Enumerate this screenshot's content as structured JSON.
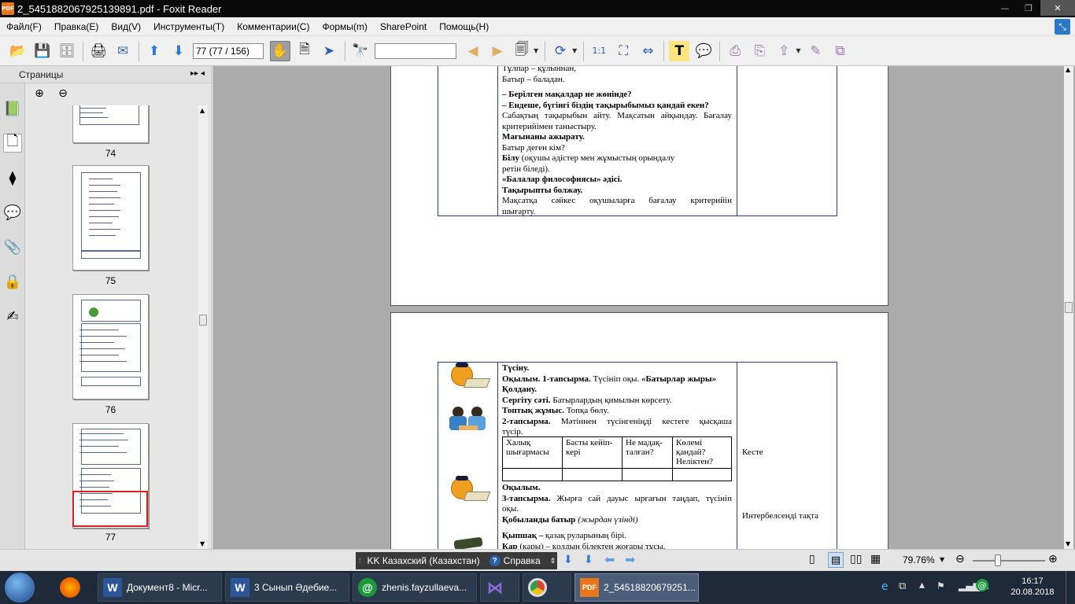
{
  "window": {
    "title": "2_5451882067925139891.pdf - Foxit Reader",
    "app_icon": "PDF"
  },
  "menu": [
    "Файл(F)",
    "Правка(E)",
    "Вид(V)",
    "Инструменты(T)",
    "Комментарии(C)",
    "Формы(m)",
    "SharePoint",
    "Помощь(H)"
  ],
  "toolbar": {
    "page_value": "77 (77 / 156)",
    "find_value": ""
  },
  "sidebar": {
    "title": "Страницы",
    "thumbs": [
      {
        "label": "74"
      },
      {
        "label": "75"
      },
      {
        "label": "76"
      },
      {
        "label": "77"
      }
    ]
  },
  "page_a": {
    "lines": [
      "Тұлпар – құлыннан,",
      "Батыр – баладан."
    ],
    "q1": "– Берілген мақалдар не жөнінде?",
    "q2": "– Ендеше, бүгінгі біздің тақырыбымыз қандай екен?",
    "p1a": "Сабақтың тақырыбын айту. Мақсатын айқындау. Бағалау",
    "p1b": "критерийімен таныстыру.",
    "h1": "Мағынаны ажырату.",
    "l1": "Батыр деген кім?",
    "l2_b": "Білу",
    "l2": " (оқушы әдістер мен жұмыстың орындалу",
    "l3": "ретін біледі).",
    "h2": "«Балалар философиясы» әдісі.",
    "h3": "Тақырыпты болжау.",
    "p2a": "Мақсатқа сәйкес оқушыларға бағалау критерийін",
    "p2b": "шығарту."
  },
  "page_b": {
    "t1": "Түсіну.",
    "t2_b": "Оқылым. 1-тапсырма.",
    "t2": " Түсініп оқы. ",
    "t2_b2": "«Батырлар жыры»",
    "t3": "Қолдану.",
    "t4_b": "Сергіту сәті.",
    "t4": " Батырлардың қимылын көрсету.",
    "t5_b": "Топтық жұмыс.",
    "t5": " Топқа бөлу.",
    "t6_b": "2-тапсырма.",
    "t6": " Мәтіннен түсінгеніңді кестеге қысқаша",
    "t6c": "түсір.",
    "inner_headers": [
      "Халық шығармасы",
      "Басты кейіп-кері",
      "Не мадақ-талған?",
      "Көлемі қандай? Неліктен?"
    ],
    "t7": "Оқылым.",
    "t8_b": "3-тапсырма.",
    "t8": " Жырға сай дауыс ырғағын таңдап, түсініп",
    "t8c": "оқы.",
    "t9_b": "Қобыланды батыр",
    "t9_i": " (жырдан үзінді)",
    "t10_b": "Қыпшақ –",
    "t10": " қазақ руларының бірі.",
    "t11_b": "Қар",
    "t11": " (қары) – қолдың білектен жоғары тұсы.",
    "r1": "Кесте",
    "r2": "Интербелсенді тақта"
  },
  "status": {
    "lang": "KK Казахский (Казахстан)",
    "help": "Справка",
    "zoom": "79.76%"
  },
  "taskbar": {
    "items": [
      "Документ8 - Micr...",
      "3 Сынып Әдебие...",
      "zhenis.fayzullaeva...",
      "",
      "",
      "2_54518820679251..."
    ],
    "time": "16:17",
    "date": "20.08.2018"
  },
  "colors": {
    "accent": "#2a3f8f",
    "selection": "#e02020",
    "taskbar": "#1e2a3a"
  }
}
